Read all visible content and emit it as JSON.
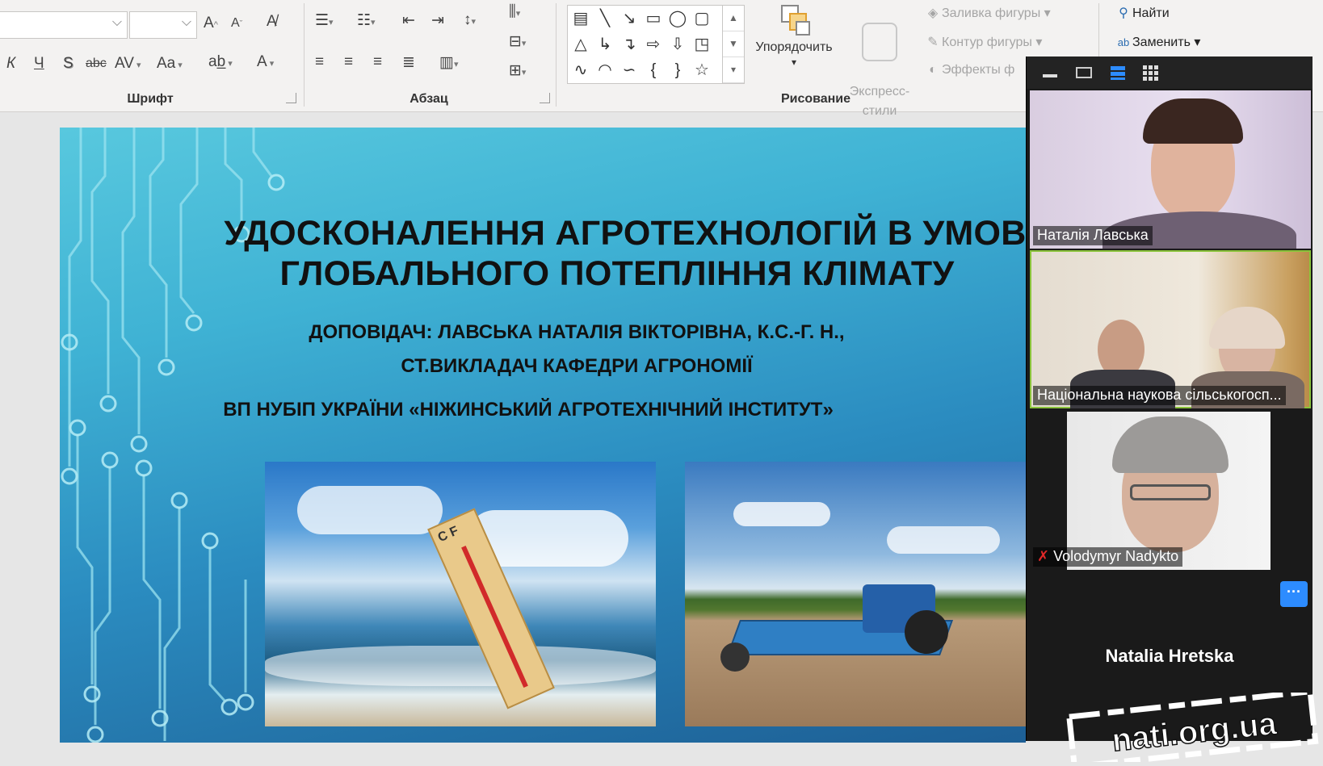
{
  "ribbon": {
    "font_group": {
      "label": "Шрифт",
      "font_name_value": "",
      "font_size_value": "",
      "grow_font": "A",
      "shrink_font": "A",
      "italic": "К",
      "underline": "Ч",
      "shadow": "S",
      "strike": "abc",
      "spacing": "AV",
      "case": "Aa",
      "color": "A"
    },
    "paragraph_group": {
      "label": "Абзац"
    },
    "drawing_group": {
      "label": "Рисование",
      "arrange": "Упорядочить",
      "express_styles": "Экспресс-\nстили",
      "shape_fill": "Заливка фигуры",
      "shape_outline": "Контур фигуры",
      "shape_effects": "Эффекты ф"
    },
    "editing": {
      "find": "Найти",
      "replace": "Заменить"
    }
  },
  "slide": {
    "title_line1": "УДОСКОНАЛЕННЯ АГРОТЕХНОЛОГІЙ В УМОВ",
    "title_line2": "ГЛОБАЛЬНОГО ПОТЕПЛІННЯ КЛІМАТУ",
    "speaker_line1": "ДОПОВІДАЧ: ЛАВСЬКА НАТАЛІЯ ВІКТОРІВНА, К.С.-Г. Н.,",
    "speaker_line2": "СТ.ВИКЛАДАЧ КАФЕДРИ АГРОНОМІЇ",
    "institution": "ВП НУБІП УКРАЇНИ «НІЖИНСЬКИЙ АГРОТЕХНІЧНИЙ ІНСТИТУТ»",
    "thermometer_scale": "C F"
  },
  "zoom": {
    "participants": [
      {
        "name": "Наталія Лавська"
      },
      {
        "name": "Національна наукова сільськогосп..."
      },
      {
        "name": "Volodymyr Nadykto"
      },
      {
        "name": "Natalia Hretska"
      }
    ],
    "more_button": "···"
  },
  "watermark": "nati.org.ua"
}
